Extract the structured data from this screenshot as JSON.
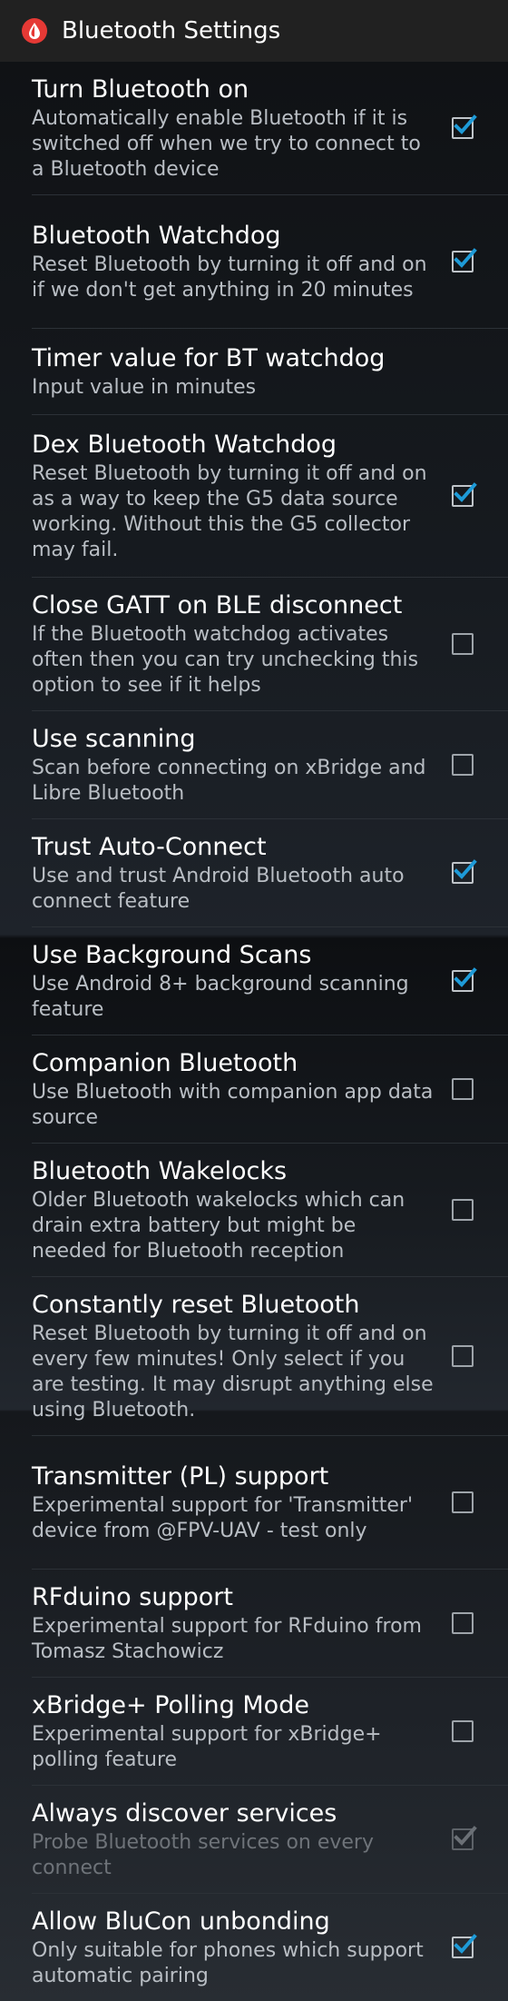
{
  "appbar": {
    "title": "Bluetooth Settings",
    "icon": "drop-logo-icon",
    "accent": "#e53935"
  },
  "colors": {
    "check_accent": "#1e9bd8",
    "background": "#111316"
  },
  "settings": [
    {
      "title": "Turn Bluetooth on",
      "summary": "Automatically enable Bluetooth if it is switched off when we try to connect to a Bluetooth device",
      "checkbox": "checked"
    },
    {
      "title": "Bluetooth Watchdog",
      "summary": "Reset Bluetooth by turning it off and on if we don't get anything in 20 minutes",
      "checkbox": "checked"
    },
    {
      "title": "Timer value for BT watchdog",
      "summary": "Input value in minutes",
      "checkbox": "none"
    },
    {
      "title": "Dex Bluetooth Watchdog",
      "summary": "Reset Bluetooth by turning it off and on as a way to keep the G5 data source working. Without this the G5 collector may fail.",
      "checkbox": "checked"
    },
    {
      "title": "Close GATT on BLE disconnect",
      "summary": "If the Bluetooth watchdog activates often then you can try unchecking this option to see if it helps",
      "checkbox": "unchecked"
    },
    {
      "title": "Use scanning",
      "summary": "Scan before connecting on xBridge and Libre Bluetooth",
      "checkbox": "unchecked"
    },
    {
      "title": "Trust Auto-Connect",
      "summary": "Use and trust Android Bluetooth auto connect feature",
      "checkbox": "checked"
    },
    {
      "title": "Use Background Scans",
      "summary": "Use Android 8+ background scanning feature",
      "checkbox": "checked"
    },
    {
      "title": "Companion Bluetooth",
      "summary": "Use Bluetooth with companion app data source",
      "checkbox": "unchecked"
    },
    {
      "title": "Bluetooth Wakelocks",
      "summary": "Older Bluetooth wakelocks which can drain extra battery but might be needed for Bluetooth reception",
      "checkbox": "unchecked"
    },
    {
      "title": "Constantly reset Bluetooth",
      "summary": "Reset Bluetooth by turning it off and on every few minutes! Only select if you are testing. It may disrupt anything else using Bluetooth.",
      "checkbox": "unchecked"
    },
    {
      "title": "Transmitter (PL) support",
      "summary": "Experimental support for 'Transmitter' device from @FPV-UAV - test only",
      "checkbox": "unchecked"
    },
    {
      "title": "RFduino support",
      "summary": "Experimental support for RFduino from Tomasz Stachowicz",
      "checkbox": "unchecked"
    },
    {
      "title": "xBridge+ Polling Mode",
      "summary": "Experimental support for xBridge+ polling feature",
      "checkbox": "unchecked"
    },
    {
      "title": "Always discover services",
      "summary": "Probe Bluetooth services on every connect",
      "checkbox": "checked-disabled"
    },
    {
      "title": "Allow BluCon unbonding",
      "summary": "Only suitable for phones which support automatic pairing",
      "checkbox": "checked"
    }
  ]
}
